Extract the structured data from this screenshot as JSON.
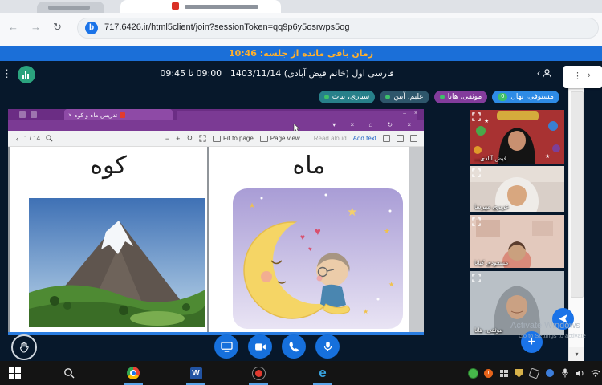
{
  "browser": {
    "url": "717.6426.ir/html5client/join?sessionToken=qq9p6y5osrwps5og",
    "favicon_letter": "b",
    "back_icon": "←",
    "forward_icon": "→",
    "refresh_icon": "↻"
  },
  "banner": {
    "text": "زمان باقی مانده از جلسه: 10:46"
  },
  "header": {
    "title": "فارسی اول (خانم فیض آبادی) 1403/11/14 | 09:00 تا 09:45",
    "kebab_icon": "⋮",
    "participants_chevron": "‹"
  },
  "student_tabs": [
    {
      "label": "مستوفی، نهال",
      "badge": "0",
      "color": "#2e8be6"
    },
    {
      "label": "موثقی، هانا",
      "color": "#833c9c"
    },
    {
      "label": "علیم، آبین",
      "color": "#2e566b"
    },
    {
      "label": "سیاری، بیات",
      "color": "#27808a"
    }
  ],
  "share_window": {
    "edge_tab": {
      "title": "تدریس ماه و کوه",
      "close_icon": "×"
    },
    "window_controls": "– ×",
    "row2_icons": "▾ × ⌂ ↻ ×",
    "pdf_toolbar": {
      "back_icon": "‹",
      "page_indicator": "1 / 14",
      "zoom_out": "−",
      "zoom_in": "+",
      "rotate_icon": "↻",
      "fit_to_page": "Fit to page",
      "page_view": "Page view",
      "read_aloud": "Read aloud",
      "add_text": "Add text"
    },
    "pages": [
      {
        "word": "کوه"
      },
      {
        "word": "ماه"
      }
    ]
  },
  "videos": [
    {
      "name": "فیض آبادی..."
    },
    {
      "name": "عزیزی مهرسا"
    },
    {
      "name": "مسعودی کیانا"
    },
    {
      "name": "موثقی، هانا"
    }
  ],
  "right_panel": {
    "kebab_icon": "⋮",
    "collapse_icon": "›",
    "scroll_down_icon": "▾"
  },
  "actions": {
    "plus_label": "+"
  },
  "watermark": {
    "line1": "Activate Windows",
    "line2": "Go to Settings to activate Windows."
  },
  "colors": {
    "banner_bg": "#1b6fd8",
    "banner_text": "#ffb02e",
    "navy": "#07182b",
    "action_blue": "#1670dc",
    "edge_purple": "#6b2d84",
    "badge_green": "#3ec16a"
  }
}
